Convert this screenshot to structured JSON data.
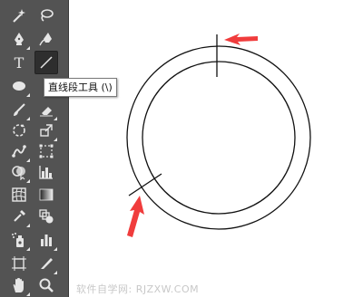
{
  "toolbar": {
    "tooltip": "直线段工具 (\\)"
  },
  "watermark": "软件自学网: RJZXW.COM",
  "colors": {
    "toolbar_bg": "#535353",
    "icon": "#e6e6e6",
    "arrow": "#f03c3c",
    "stroke": "#111111"
  }
}
